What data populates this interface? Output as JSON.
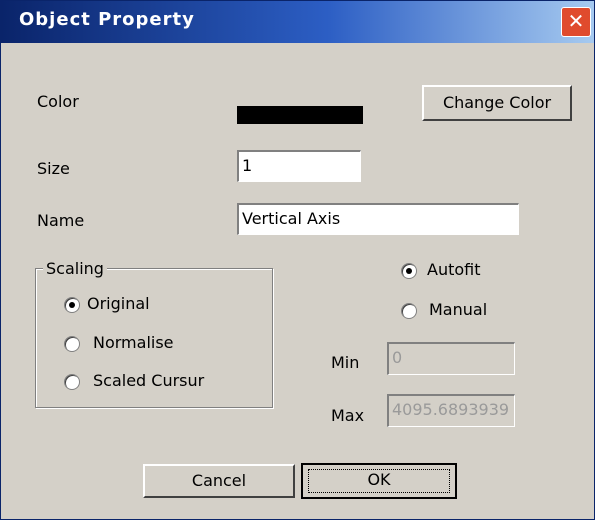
{
  "window": {
    "title": "Object Property",
    "close_glyph": "✕"
  },
  "color": {
    "label": "Color",
    "swatch_color": "#000000",
    "change_button": "Change Color"
  },
  "size": {
    "label": "Size",
    "value": "1"
  },
  "name": {
    "label": "Name",
    "value": "Vertical Axis"
  },
  "scaling": {
    "group_label": "Scaling",
    "options": [
      "Original",
      "Normalise",
      "Scaled Cursur"
    ],
    "selected": "Original"
  },
  "range": {
    "options": [
      "Autofit",
      "Manual"
    ],
    "selected": "Autofit",
    "min_label": "Min",
    "min_value": "0",
    "max_label": "Max",
    "max_value": "4095.6893939"
  },
  "buttons": {
    "cancel": "Cancel",
    "ok": "OK"
  }
}
